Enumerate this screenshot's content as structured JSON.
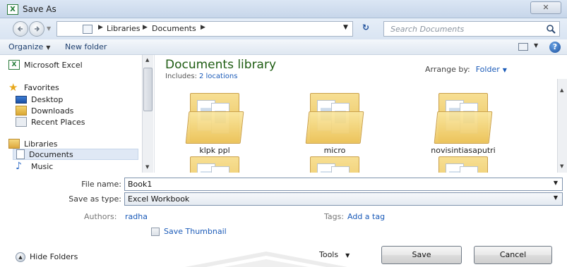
{
  "window": {
    "title": "Save As",
    "close_label": "✕"
  },
  "address": {
    "crumbs": [
      "Libraries",
      "Documents"
    ],
    "search_placeholder": "Search Documents"
  },
  "toolbar": {
    "organize": "Organize",
    "new_folder": "New folder"
  },
  "nav": {
    "items": [
      {
        "label": "Microsoft Excel",
        "icon": "excel-icon"
      },
      {
        "label": "Favorites",
        "icon": "star-icon"
      },
      {
        "label": "Desktop",
        "icon": "desktop-icon"
      },
      {
        "label": "Downloads",
        "icon": "downloads-icon"
      },
      {
        "label": "Recent Places",
        "icon": "recent-places-icon"
      },
      {
        "label": "Libraries",
        "icon": "libraries-icon"
      },
      {
        "label": "Documents",
        "icon": "documents-icon"
      },
      {
        "label": "Music",
        "icon": "music-icon"
      }
    ]
  },
  "library": {
    "title": "Documents library",
    "includes_label": "Includes:",
    "includes_link": "2 locations",
    "arrange_label": "Arrange by:",
    "arrange_value": "Folder"
  },
  "folders": [
    {
      "name": "klpk ppl"
    },
    {
      "name": "micro"
    },
    {
      "name": "novisintiasaputri"
    }
  ],
  "form": {
    "file_name_label": "File name:",
    "file_name_value": "Book1",
    "save_type_label": "Save as type:",
    "save_type_value": "Excel Workbook",
    "authors_label": "Authors:",
    "authors_value": "radha",
    "tags_label": "Tags:",
    "tags_value": "Add a tag",
    "thumbnail_label": "Save Thumbnail",
    "hide_folders": "Hide Folders",
    "tools": "Tools",
    "save": "Save",
    "cancel": "Cancel"
  }
}
